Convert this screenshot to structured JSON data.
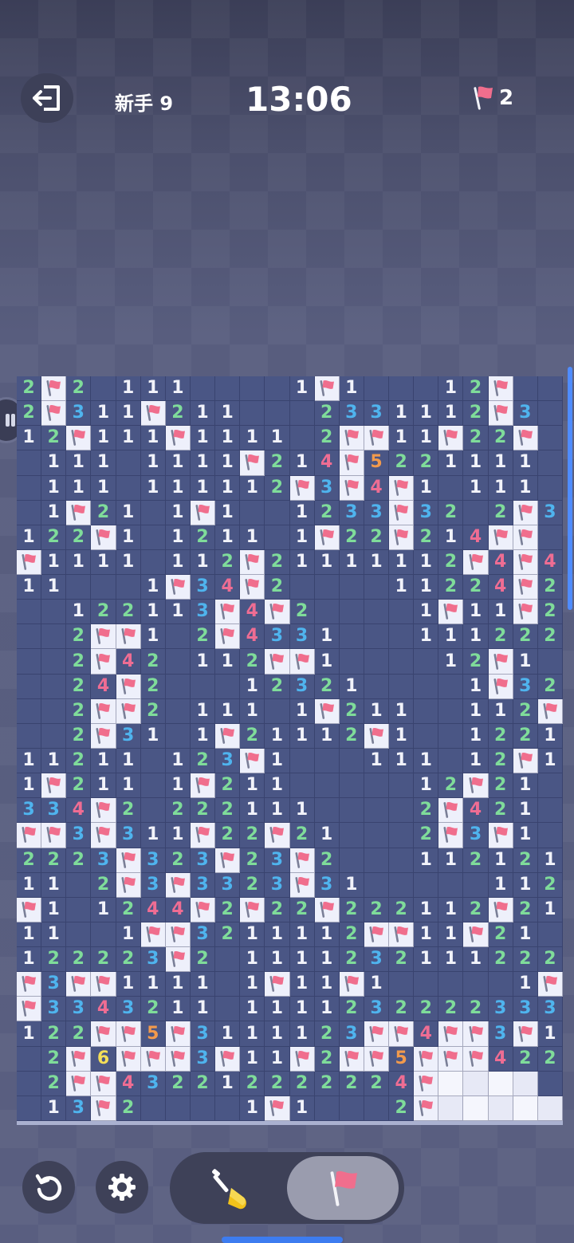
{
  "header": {
    "level_label": "新手 9",
    "timer": "13:06",
    "flags_remaining": "2"
  },
  "icons": {
    "exit": "exit-icon",
    "flag": "flag-icon",
    "restart": "restart-icon",
    "settings": "gear-icon",
    "dig": "shovel-icon"
  },
  "colors": {
    "n1": "#f2f3fa",
    "n2": "#7fdc9a",
    "n3": "#4fb4ee",
    "n4": "#ef6d93",
    "n5": "#f29a4c",
    "n6": "#f3dd58",
    "flag": "#f06e8d",
    "board": "#4a5685"
  },
  "board": {
    "columns": 22,
    "rows": [
      "2F2.111....1F1...12F",
      "2F311F211...233111 2F3",
      "12F111F1111.2FF11F22F",
      ".111.1111F214F5221111",
      ".111.11111 2F3F4F1.111",
      ".1F21.1F1..12 33F32.2F3",
      "122F1.12 11.1F22F214FF",
      "F1111.112F21111112F4F4",
      "11...1F34F2....11224F2",
      "..1 2211 3F4F2....1F11F21",
      "..2FF1.2F4331...1112 22.",
      "..2F42.112FF1....12F1.",
      "..24F2...12321....1F321",
      "..2FF2.111.1F211..112F1",
      "..2F31.1F21112F1..1221",
      "11211.123F1...111.12F1.",
      "1F211.1F211.....12F21.",
      "334F2.222111....2F421.",
      "FF3F311F22F21...2F3F1.",
      "2223F323F23F2...112121",
      "11.2F3F33 23F31.....112F",
      "F1.1244F2F22F22211 2F21",
      "11..1FF321111 2FF11F21.",
      "122223F2.1111232111222",
      "F3FF1111.1F11F1.....1FF",
      "F334321 1.1111232222333",
      "122FF5F3111123FF4FF3F1",
      ".2F6FFF3F11F2FF5FFF422",
      ".2FF43221222222 4F CCCC",
      ".13F2....1F1...2F CCCCC"
    ]
  }
}
